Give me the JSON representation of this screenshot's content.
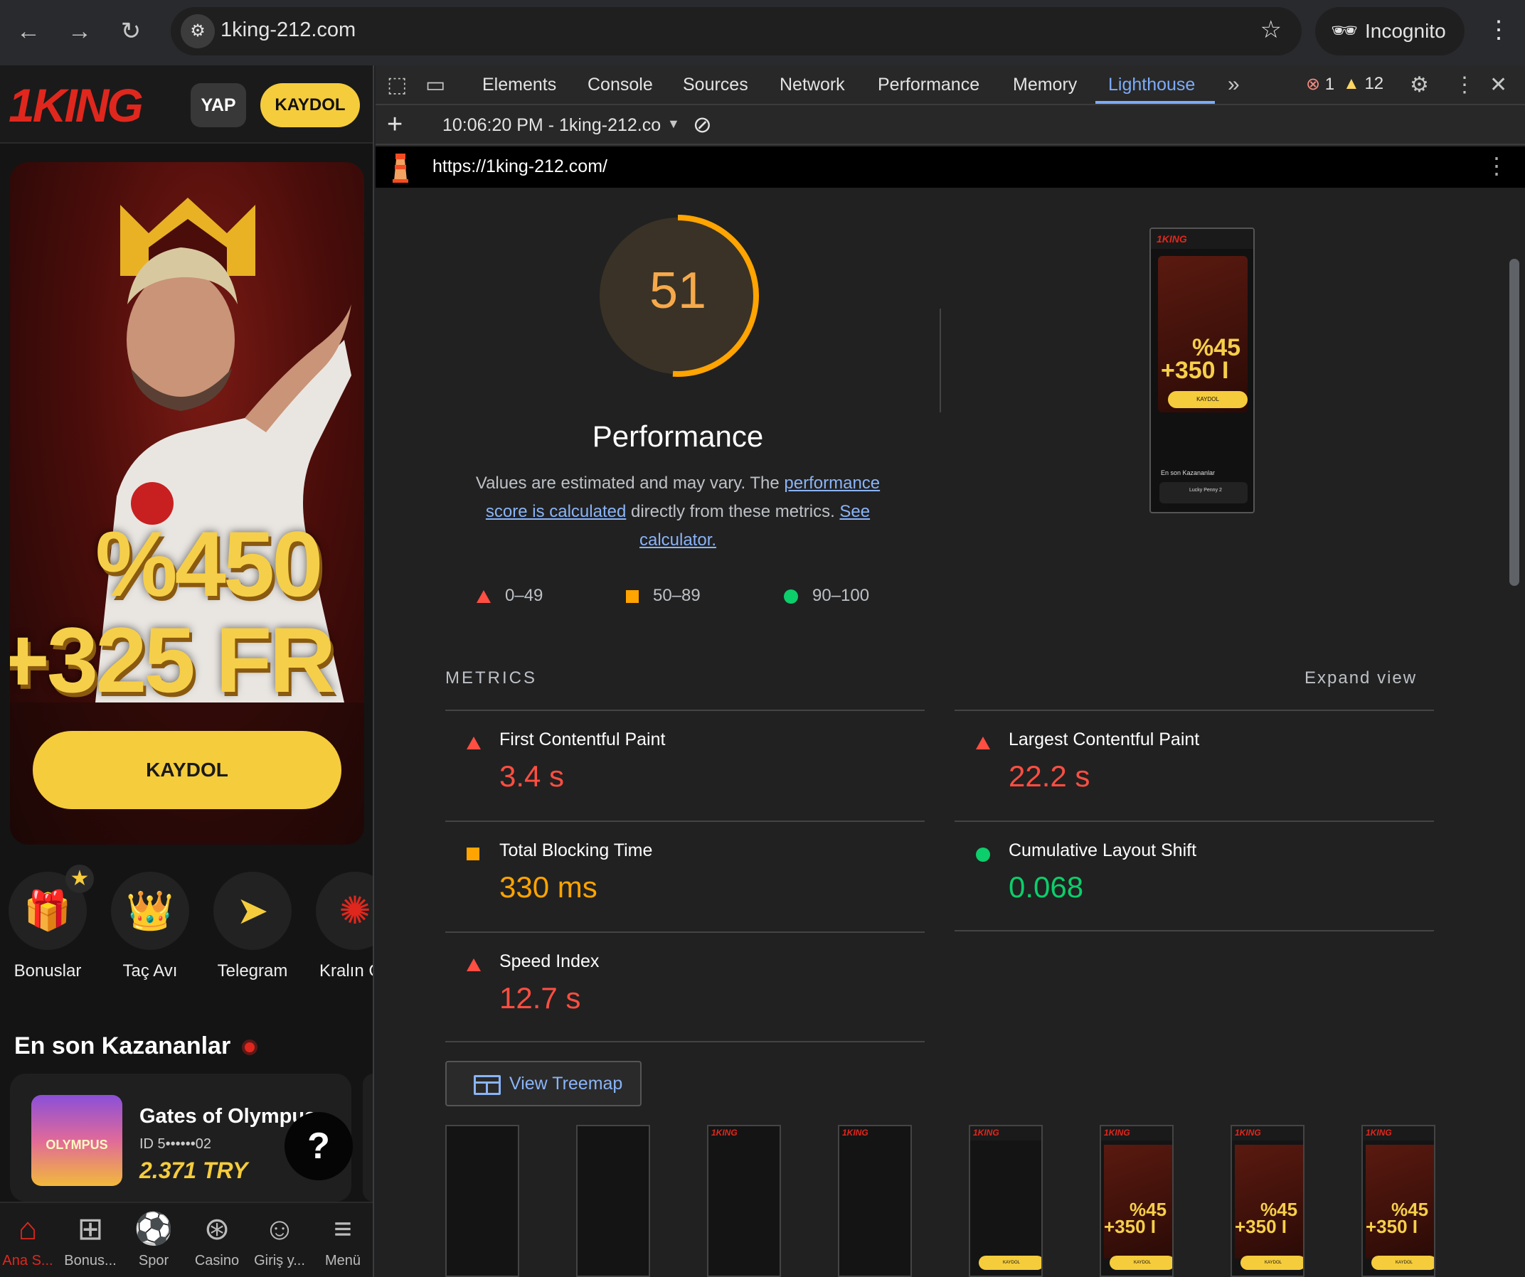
{
  "browser": {
    "url": "1king-212.com",
    "profile": "Incognito"
  },
  "site": {
    "logo": "1KING",
    "login_label": "YAP",
    "signup_label": "KAYDOL",
    "banner": {
      "promo_line1": "%450",
      "promo_line2": "+325 FR",
      "cta": "KAYDOL"
    },
    "categories": [
      {
        "label": "Bonuslar",
        "icon": "gift-icon"
      },
      {
        "label": "Taç Avı",
        "icon": "crown-icon"
      },
      {
        "label": "Telegram",
        "icon": "paper-plane-icon"
      },
      {
        "label": "Kralın Ça",
        "icon": "wheel-icon"
      }
    ],
    "winners": {
      "title": "En son Kazananlar",
      "game": "Gates of Olympus",
      "id": "ID 5••••••02",
      "amount": "2.371 TRY",
      "thumb_text": "OLYMPUS"
    },
    "help_label": "?",
    "bottom_nav": [
      {
        "label": "Ana S...",
        "icon": "home-icon"
      },
      {
        "label": "Bonus...",
        "icon": "gift-icon"
      },
      {
        "label": "Spor",
        "icon": "soccer-ball-icon"
      },
      {
        "label": "Casino",
        "icon": "casino-chip-icon"
      },
      {
        "label": "Giriş y...",
        "icon": "user-icon"
      },
      {
        "label": "Menü",
        "icon": "hamburger-icon"
      }
    ]
  },
  "devtools": {
    "tabs": [
      "Elements",
      "Console",
      "Sources",
      "Network",
      "Performance",
      "Memory",
      "Lighthouse"
    ],
    "active_tab": "Lighthouse",
    "error_count": "1",
    "warning_count": "12",
    "report_selector": "10:06:20 PM - 1king-212.co",
    "report_url": "https://1king-212.com/"
  },
  "lighthouse": {
    "score": "51",
    "score_fraction": 0.51,
    "category": "Performance",
    "desc_pre": "Values are estimated and may vary. The ",
    "desc_link1": "performance score is calculated",
    "desc_mid": " directly from these metrics. ",
    "desc_link2": "See calculator.",
    "legend": [
      {
        "range": "0–49",
        "color": "#ff4e42"
      },
      {
        "range": "50–89",
        "color": "#ffa400"
      },
      {
        "range": "90–100",
        "color": "#0cce6b"
      }
    ],
    "metrics_heading": "METRICS",
    "expand_label": "Expand view",
    "metrics": [
      {
        "name": "First Contentful Paint",
        "value": "3.4 s",
        "rating": "fail"
      },
      {
        "name": "Largest Contentful Paint",
        "value": "22.2 s",
        "rating": "fail"
      },
      {
        "name": "Total Blocking Time",
        "value": "330 ms",
        "rating": "average"
      },
      {
        "name": "Cumulative Layout Shift",
        "value": "0.068",
        "rating": "pass"
      },
      {
        "name": "Speed Index",
        "value": "12.7 s",
        "rating": "fail"
      }
    ],
    "treemap_label": "View Treemap",
    "screenshot": {
      "logo": "1KING",
      "promo_line1": "%45",
      "promo_line2": "+350 I",
      "cta": "KAYDOL",
      "winners": "En son Kazananlar",
      "card": "Lucky Penny 2"
    },
    "filmstrip": {
      "logo": "1KING",
      "promo_line1": "%45",
      "promo_line2": "+350 I",
      "cta": "KAYDOL"
    }
  }
}
